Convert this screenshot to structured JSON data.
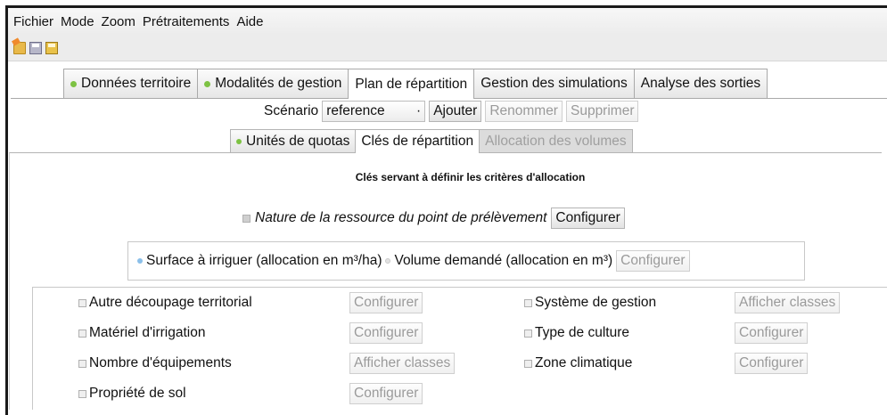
{
  "menu": [
    "Fichier",
    "Mode",
    "Zoom",
    "Prétraitements",
    "Aide"
  ],
  "toolbar_icons": [
    "open-folder-icon",
    "save-icon",
    "save-as-icon"
  ],
  "main_tabs": [
    {
      "label": "Données territoire",
      "dot": true
    },
    {
      "label": "Modalités de gestion",
      "dot": true
    },
    {
      "label": "Plan de répartition",
      "dot": false,
      "active": true
    },
    {
      "label": "Gestion des simulations",
      "dot": false
    },
    {
      "label": "Analyse des sorties",
      "dot": false
    }
  ],
  "scenario": {
    "label": "Scénario",
    "value": "reference",
    "arrow": "·",
    "add": "Ajouter",
    "rename": "Renommer",
    "delete": "Supprimer"
  },
  "sub_tabs": [
    {
      "label": "Unités de quotas",
      "dot": true
    },
    {
      "label": "Clés de répartition",
      "active": true
    },
    {
      "label": "Allocation des volumes",
      "disabled": true
    }
  ],
  "heading": "Clés servant à définir les critères d'allocation",
  "nature": {
    "label": "Nature de la ressource du point de prélèvement",
    "button": "Configurer"
  },
  "allocation": {
    "surface": "Surface à irriguer (allocation en m³/ha)",
    "volume": "Volume demandé (allocation en m³)",
    "button": "Configurer"
  },
  "criteria": {
    "c1": {
      "label": "Autre découpage territorial",
      "button": "Configurer"
    },
    "c2": {
      "label": "Matériel d'irrigation",
      "button": "Configurer"
    },
    "c3": {
      "label": "Nombre d'équipements",
      "button": "Afficher classes"
    },
    "c4": {
      "label": "Propriété de sol",
      "button": "Configurer"
    },
    "c5": {
      "label": "Système de gestion",
      "button": "Afficher classes"
    },
    "c6": {
      "label": "Type de culture",
      "button": "Configurer"
    },
    "c7": {
      "label": "Zone climatique",
      "button": "Configurer"
    }
  }
}
